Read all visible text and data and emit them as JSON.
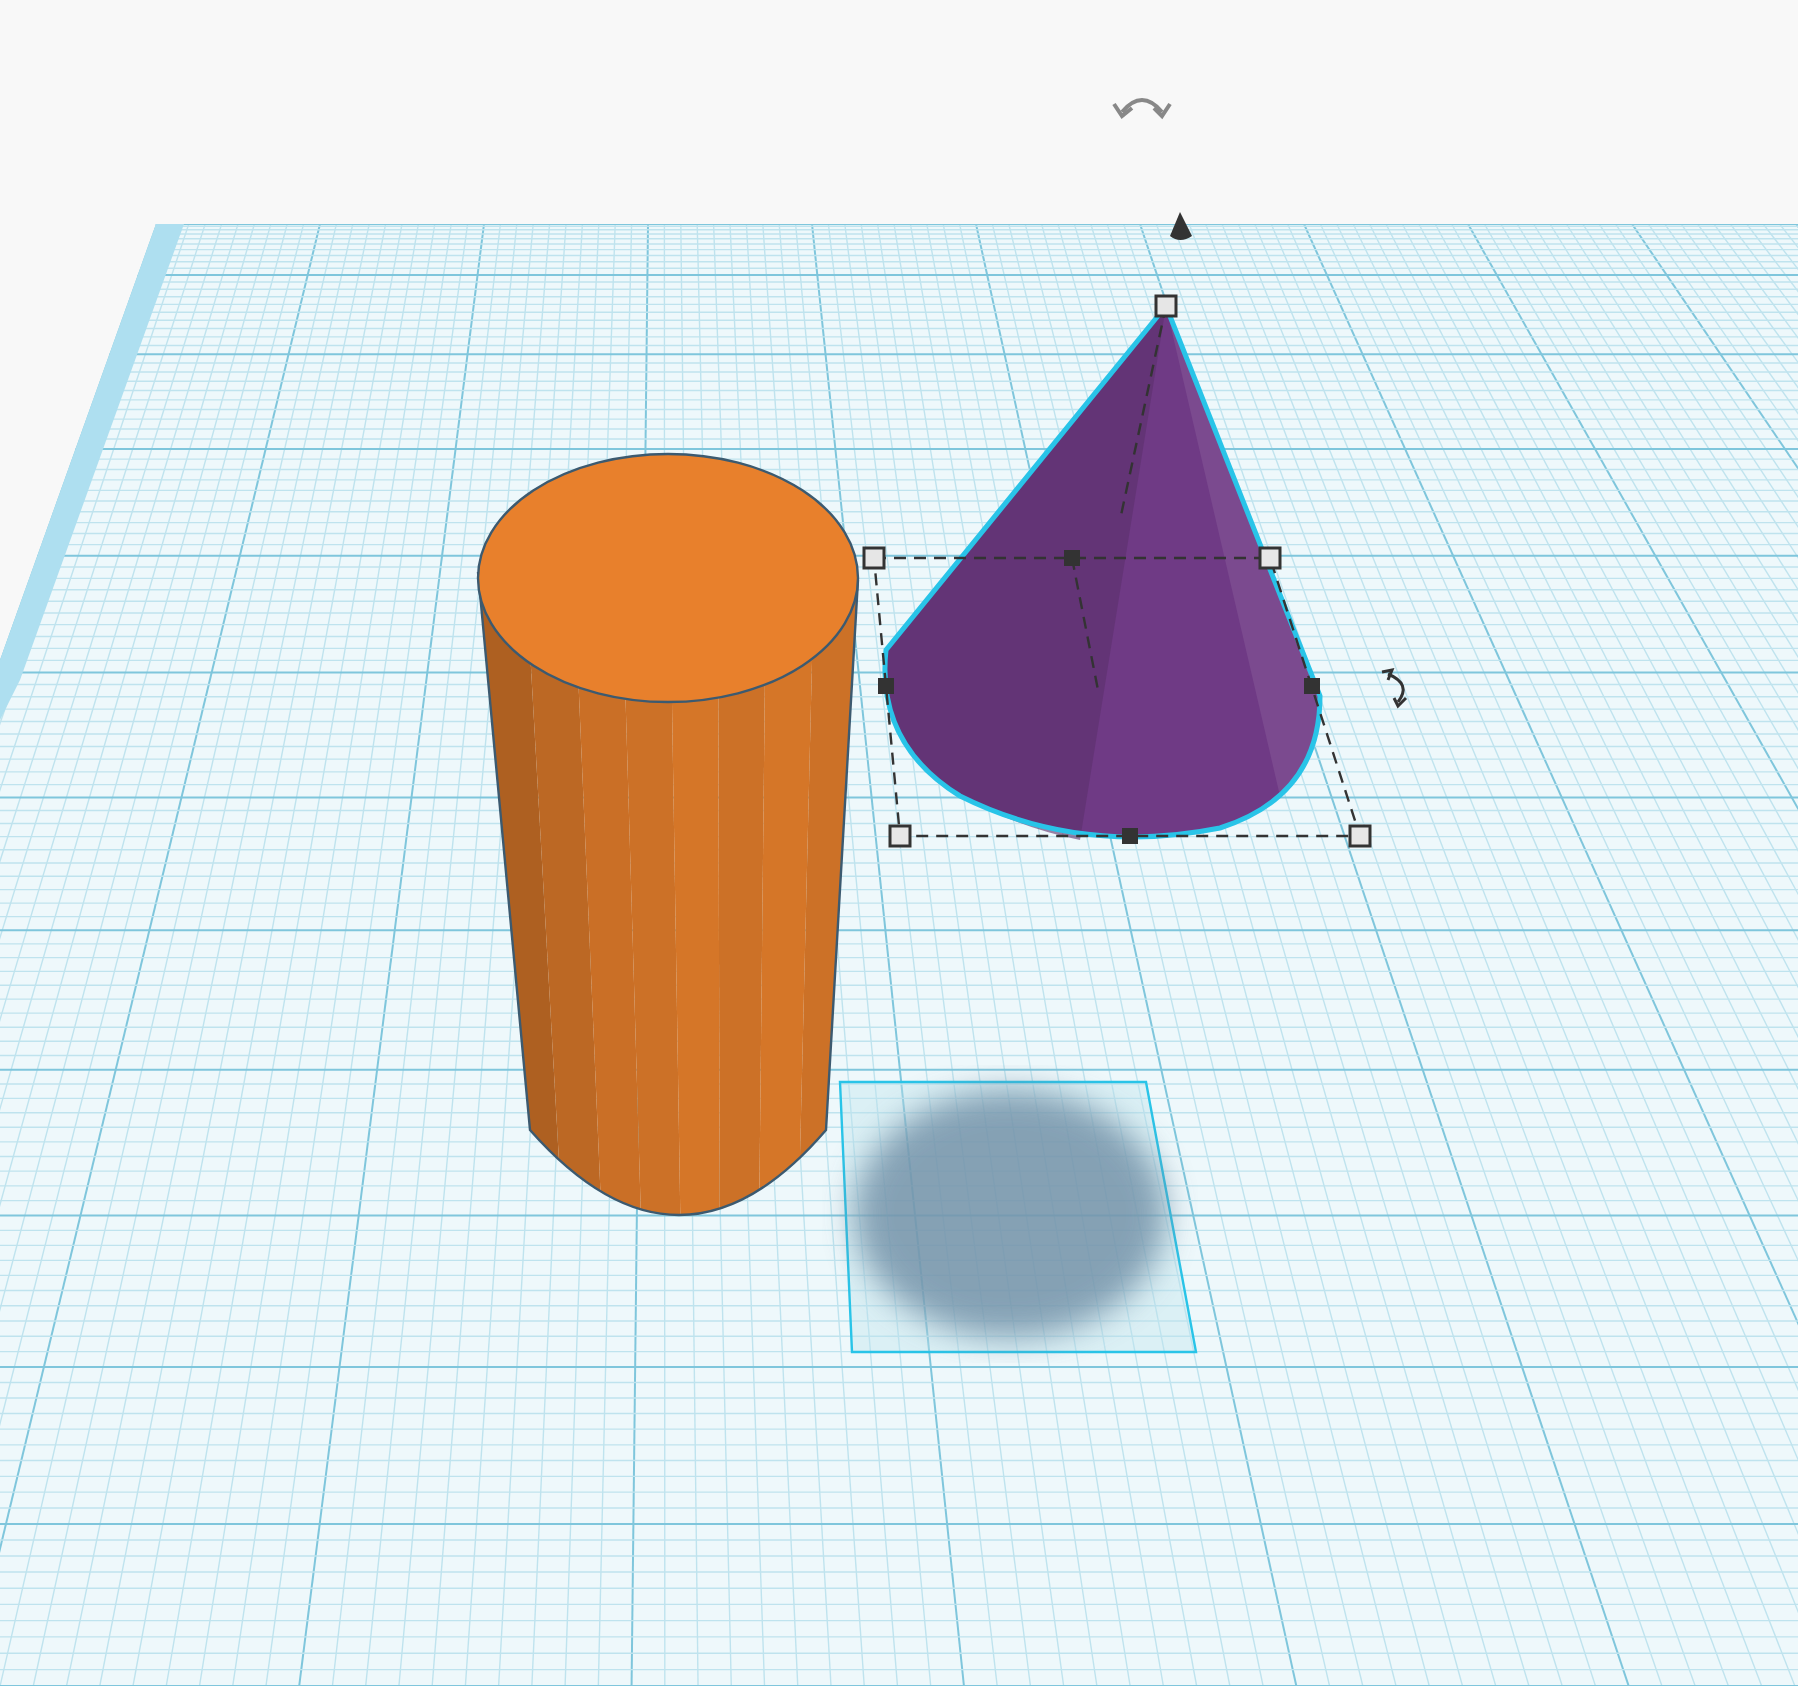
{
  "workplane": {
    "shapes": [
      {
        "kind": "cylinder",
        "color": "#e8802c",
        "selected": false
      },
      {
        "kind": "cone",
        "color": "#6f3a85",
        "selected": true
      }
    ]
  }
}
